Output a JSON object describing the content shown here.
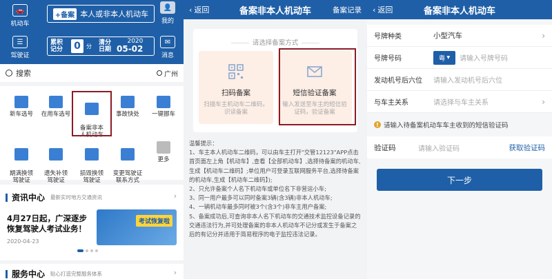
{
  "home": {
    "top_left_icons": [
      {
        "label": "机动车",
        "icon": "car-icon"
      },
      {
        "label": "驾驶证",
        "icon": "license-icon"
      }
    ],
    "register_box": {
      "tag": "+备案",
      "text": "本人或非本人机动车"
    },
    "score": {
      "label": "累积记分",
      "value": "0",
      "unit": "分",
      "date_label": "清分日期",
      "year": "2020",
      "date": "05-02"
    },
    "top_right_icons": [
      {
        "label": "我的",
        "icon": "user-icon"
      },
      {
        "label": "消息",
        "icon": "mail-icon"
      }
    ],
    "search": {
      "placeholder": "搜索",
      "city": "广州"
    },
    "grid": [
      {
        "label": "新车选号",
        "color": "#3b7fd4"
      },
      {
        "label": "在用车选号",
        "color": "#3b7fd4"
      },
      {
        "label": "备案非本\n人机动车",
        "color": "#3b7fd4"
      },
      {
        "label": "事故快处",
        "color": "#3b7fd4"
      },
      {
        "label": "一键挪车",
        "color": "#3b7fd4"
      },
      {
        "label": "期满换领\n驾驶证",
        "color": "#3b7fd4"
      },
      {
        "label": "遗失补领\n驾驶证",
        "color": "#3b7fd4"
      },
      {
        "label": "损毁换领\n驾驶证",
        "color": "#3b7fd4"
      },
      {
        "label": "变更驾驶证\n联系方式",
        "color": "#3b7fd4"
      },
      {
        "label": "更多",
        "color": "#bbbbbb"
      }
    ],
    "news": {
      "title": "资讯中心",
      "subtitle": "最新实时地方交通资讯",
      "headline": "4月27日起，广深逐步恢复驾驶人考试业务！",
      "date": "2020-04-23",
      "image_tag": "考试恢复啦"
    },
    "service": {
      "title": "服务中心",
      "subtitle": "贴心打造完整服务体系"
    }
  },
  "filing": {
    "back": "返回",
    "title": "备案非本人机动车",
    "right": "备案记录",
    "method_title": "请选择备案方式",
    "options": [
      {
        "label": "扫码备案",
        "desc": "扫描车主机动车二维码，识读备案",
        "icon": "qr-icon"
      },
      {
        "label": "短信验证备案",
        "desc": "输入发送至车主的短信验证码，验证备案",
        "icon": "envelope-icon"
      }
    ],
    "notice_title": "温馨提示：",
    "notice": [
      "1、车主本人机动车二维码，可以由车主打开\"交管12123\"APP点击首页面左上角【机动车】,查看【全部机动车】,选择待备案的机动车,生成【机动车二维码】;单位用户可登录互联网服务平台,选择待备案的机动车,生成【机动车二维码】);",
      "2、只允许备案个人名下机动车或单位名下非营运小车;",
      "3、同一用户最多可以同时备案3辆(含3辆)非本人机动车;",
      "4、一辆机动车最多同时被3个(含3个)非车主用户备案;",
      "5、备案成功后,可查询非本人名下机动车的交通技术监控设备记录的交通违法行为,并可处理备案的非本人机动车不记分或发生于备案之后的有记分并适用于简易程序的电子监控违法记录。"
    ]
  },
  "form": {
    "back": "返回",
    "title": "备案非本人机动车",
    "rows": [
      {
        "label": "号牌种类",
        "value": "小型汽车",
        "placeholder": ""
      },
      {
        "label": "号牌号码",
        "value": "",
        "prefix": "粤",
        "placeholder": "请输入号牌号码"
      },
      {
        "label": "发动机号后六位",
        "value": "",
        "placeholder": "请输入发动机号后六位"
      },
      {
        "label": "与车主关系",
        "value": "",
        "placeholder": "请选择与车主关系"
      }
    ],
    "hint": "请输入待备案机动车车主收到的短信验证码",
    "vcode_label": "验证码",
    "vcode_placeholder": "请输入验证码",
    "get_code": "获取验证码",
    "next": "下一步"
  },
  "colors": {
    "primary": "#1f5fa7",
    "highlight": "#8a1b23",
    "warning": "#e0a52b"
  }
}
